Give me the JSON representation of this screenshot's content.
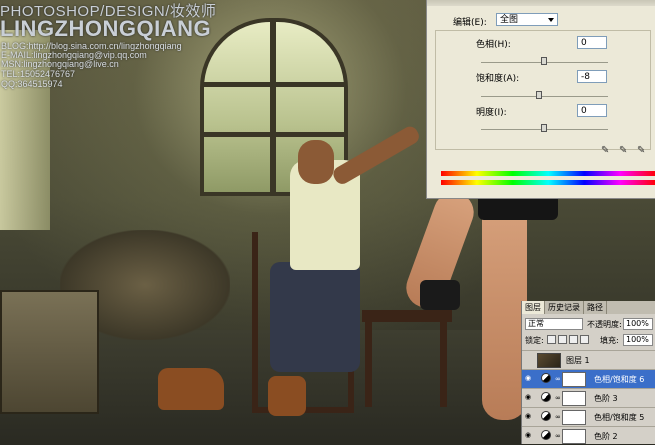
{
  "watermark": {
    "title": "PHOTOSHOP/DESIGN/妆效师",
    "name": "LINGZHONGQIANG",
    "lines": [
      "BLOG:http://blog.sina.com.cn/lingzhongqiang",
      "E-MAIL:lingzhongqiang@vip.qq.com",
      "MSN:lingzhongqiang@live.cn",
      "TEL:15052476767",
      "QQ:364515974"
    ]
  },
  "hue_saturation": {
    "edit_label": "编辑(E):",
    "edit_value": "全图",
    "hue_label": "色相(H):",
    "hue_value": "0",
    "saturation_label": "饱和度(A):",
    "saturation_value": "-8",
    "lightness_label": "明度(I):",
    "lightness_value": "0"
  },
  "layers_panel": {
    "tabs": [
      "图层",
      "历史记录",
      "路径"
    ],
    "blend_mode": "正常",
    "opacity_label": "不透明度:",
    "opacity_value": "100%",
    "lock_label": "锁定:",
    "fill_label": "填充:",
    "fill_value": "100%",
    "layers": [
      {
        "name": "图层 1",
        "selected": false
      },
      {
        "name": "色相/饱和度 6",
        "selected": true
      },
      {
        "name": "色阶 3",
        "selected": false
      },
      {
        "name": "色相/饱和度 5",
        "selected": false
      },
      {
        "name": "色阶 2",
        "selected": false
      }
    ]
  }
}
